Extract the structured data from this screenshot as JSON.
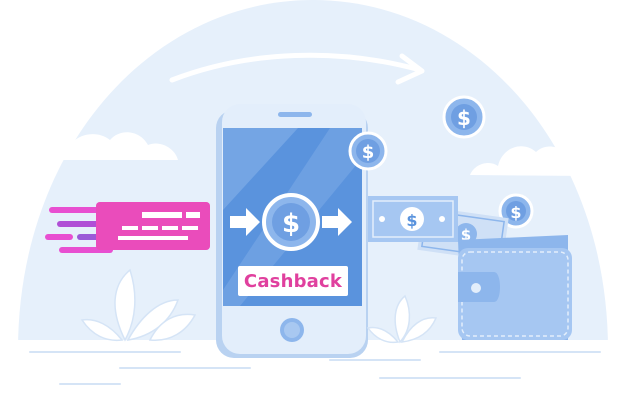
{
  "label": "Cashback",
  "colors": {
    "backdrop": "#e6f0fb",
    "light_blue": "#c9dcf4",
    "phone_blue": "#5a93dd",
    "phone_dark": "#4a80cc",
    "coin": "#8db6ec",
    "bill": "#a6c7f2",
    "wallet": "#9fc1ee",
    "card_pink": "#e84fd1",
    "card_magenta": "#ec4aa6",
    "label_text": "#e0409e"
  },
  "icons": [
    "dollar-coin-icon",
    "arrow-right-icon",
    "wallet-icon",
    "credit-card-icon",
    "banknote-icon",
    "cloud-icon",
    "plant-icon"
  ]
}
